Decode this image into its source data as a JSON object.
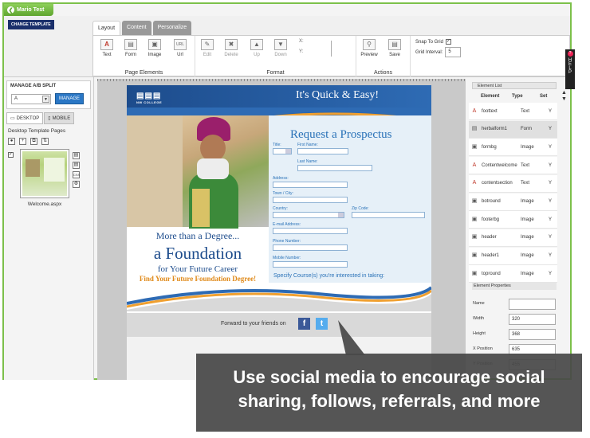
{
  "window": {
    "tab_title": "Mario Test",
    "back_icon": "back-arrow-icon"
  },
  "toolbar": {
    "change_template": "CHANGE TEMPLATE",
    "tabs": [
      "Layout",
      "Content",
      "Personalize"
    ],
    "page_elements": {
      "label": "Page Elements",
      "tools": [
        "Text",
        "Form",
        "Image",
        "Url"
      ]
    },
    "format": {
      "label": "Format",
      "tools": [
        "Edit",
        "Delete",
        "Up",
        "Down"
      ],
      "x_label": "X:",
      "y_label": "Y:"
    },
    "actions": {
      "label": "Actions",
      "tools": [
        "Preview",
        "Save"
      ]
    },
    "snap_to_grid": {
      "label": "Snap To Grid",
      "checked": true
    },
    "grid_interval": {
      "label": "Grid Interval:",
      "value": "5"
    }
  },
  "left_panel": {
    "ab_title": "MANAGE A/B SPLIT",
    "ab_select_value": "A",
    "manage_label": "MANAGE",
    "device_tabs": [
      "DESKTOP",
      "MOBILE"
    ],
    "pages_title": "Desktop Template Pages",
    "page_name": "Welcome.aspx",
    "css_label": "CSS"
  },
  "email": {
    "logo": "NW COLLEGE",
    "tagline": "It's Quick & Easy!",
    "form_title": "Request a Prospectus",
    "labels": {
      "title": "Title:",
      "first_name": "First Name:",
      "last_name": "Last Name:",
      "address": "Address:",
      "town": "Town / City:",
      "country": "Country:",
      "zip": "Zip Code:",
      "email": "E-mail Address:",
      "phone": "Phone Number:",
      "mobile": "Mobile Number:"
    },
    "course_text": "Specify Course(s) you're interested in taking:",
    "line1": "More than a Degree...",
    "line2": "a Foundation",
    "line3": "for Your Future Career",
    "line4": "Find Your Future Foundation Degree!",
    "forward_text": "Forward to your friends on",
    "facebook_label": "f",
    "twitter_label": "t"
  },
  "right_panel": {
    "list_title": "Element List",
    "headers": [
      "Element",
      "Type",
      "Set"
    ],
    "rows": [
      {
        "name": "foottext",
        "type": "Text",
        "set": "Y",
        "icon": "text-icon"
      },
      {
        "name": "herbalform1",
        "type": "Form",
        "set": "Y",
        "icon": "form-icon"
      },
      {
        "name": "formbg",
        "type": "Image",
        "set": "Y",
        "icon": "image-icon"
      },
      {
        "name": "Contentwelcome",
        "type": "Text",
        "set": "Y",
        "icon": "text-icon"
      },
      {
        "name": "contentsection",
        "type": "Text",
        "set": "Y",
        "icon": "text-icon"
      },
      {
        "name": "botround",
        "type": "Image",
        "set": "Y",
        "icon": "image-icon"
      },
      {
        "name": "footerbg",
        "type": "Image",
        "set": "Y",
        "icon": "image-icon"
      },
      {
        "name": "header",
        "type": "Image",
        "set": "Y",
        "icon": "image-icon"
      },
      {
        "name": "header1",
        "type": "Image",
        "set": "Y",
        "icon": "image-icon"
      },
      {
        "name": "topround",
        "type": "Image",
        "set": "Y",
        "icon": "image-icon"
      }
    ],
    "props_title": "Element Properties",
    "props": [
      {
        "label": "Name",
        "value": ""
      },
      {
        "label": "Width",
        "value": "320"
      },
      {
        "label": "Height",
        "value": "368"
      },
      {
        "label": "X Position",
        "value": "635"
      },
      {
        "label": "Y Position",
        "value": "455"
      }
    ]
  },
  "help_label": "HELP",
  "callout": {
    "line1": "Use social media to encourage social",
    "line2": "sharing, follows, referrals, and more"
  }
}
